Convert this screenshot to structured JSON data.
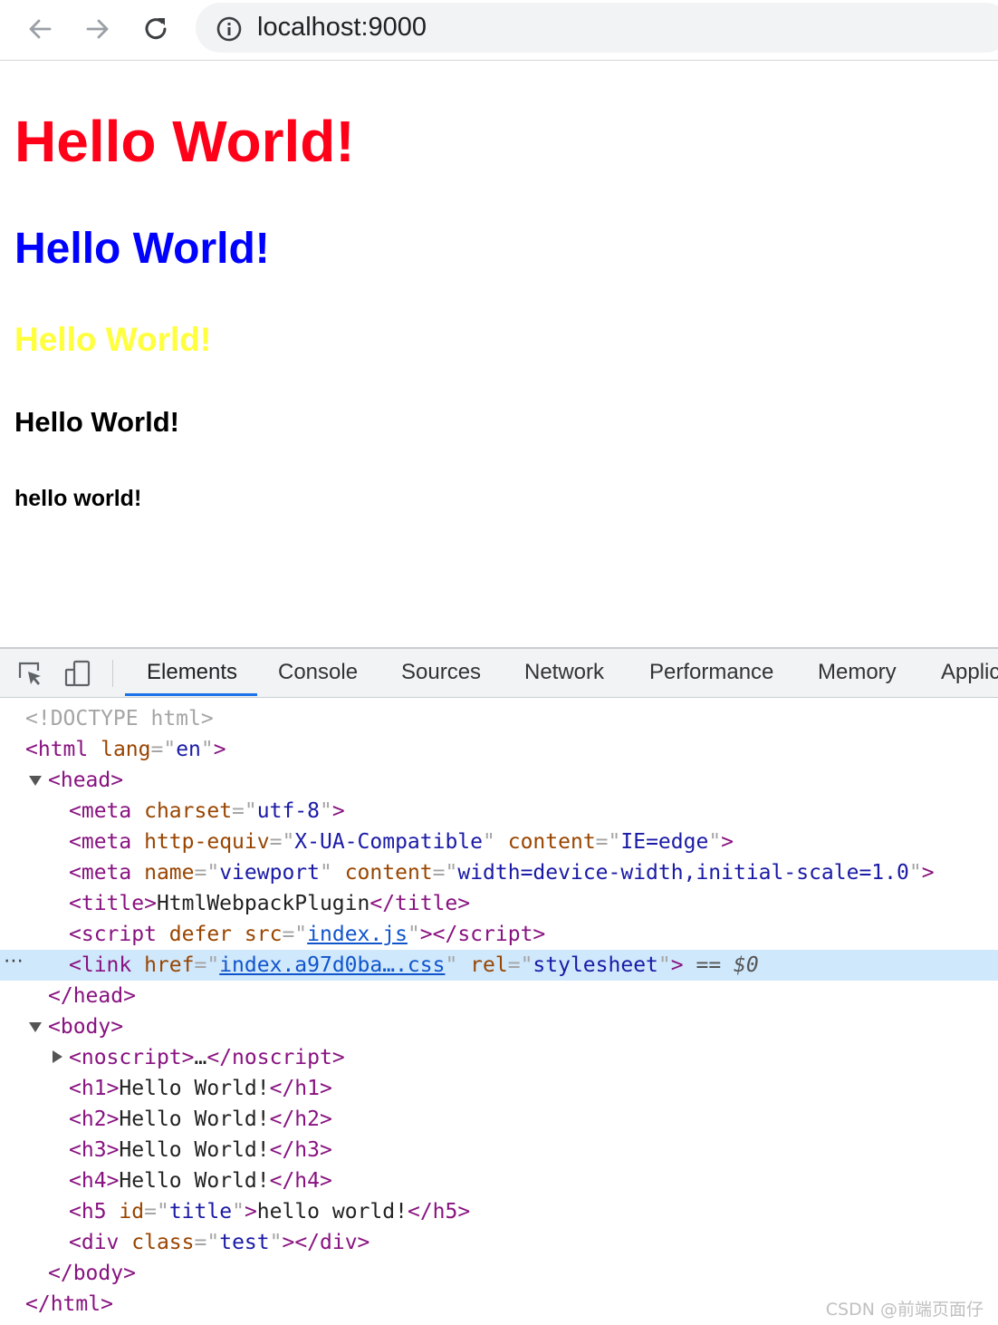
{
  "browser": {
    "url": "localhost:9000",
    "icons": {
      "back": "back-arrow-icon",
      "forward": "forward-arrow-icon",
      "reload": "reload-icon",
      "info": "info-icon"
    }
  },
  "page": {
    "h1": "Hello World!",
    "h2": "Hello World!",
    "h3": "Hello World!",
    "h4": "Hello World!",
    "h5": "hello world!",
    "colors": {
      "h1": "#ff0019",
      "h2": "#0000ff",
      "h3": "#ffff3d",
      "h4": "#000000",
      "h5": "#000000"
    }
  },
  "devtools": {
    "tabs": [
      "Elements",
      "Console",
      "Sources",
      "Network",
      "Performance",
      "Memory",
      "Applic"
    ],
    "active_tab": "Elements",
    "accent_color": "#1a73e8",
    "selected_row_color": "#cfe8fc",
    "tree": {
      "doctype": "<!DOCTYPE html>",
      "html_open": {
        "tag": "html",
        "attr": "lang",
        "value": "en"
      },
      "head": "head",
      "meta1": {
        "attr": "charset",
        "value": "utf-8"
      },
      "meta2": {
        "attr1": "http-equiv",
        "value1": "X-UA-Compatible",
        "attr2": "content",
        "value2": "IE=edge"
      },
      "meta3": {
        "attr1": "name",
        "value1": "viewport",
        "attr2": "content",
        "value2": "width=device-width,initial-scale=1.0"
      },
      "title": {
        "text": "HtmlWebpackPlugin"
      },
      "script": {
        "attr1": "defer",
        "attr2": "src",
        "value2": "index.js"
      },
      "link": {
        "attr1": "href",
        "value1": "index.a97d0ba….css",
        "attr2": "rel",
        "value2": "stylesheet",
        "marker": "== $0"
      },
      "head_close": "head",
      "body": "body",
      "noscript": {
        "tag": "noscript",
        "ellipsis": "…"
      },
      "h1": {
        "tag": "h1",
        "text": "Hello World!"
      },
      "h2": {
        "tag": "h2",
        "text": "Hello World!"
      },
      "h3": {
        "tag": "h3",
        "text": "Hello World!"
      },
      "h4": {
        "tag": "h4",
        "text": "Hello World!"
      },
      "h5": {
        "tag": "h5",
        "attr": "id",
        "value": "title",
        "text": "hello world!"
      },
      "div": {
        "tag": "div",
        "attr": "class",
        "value": "test"
      },
      "body_close": "body",
      "html_close": "html"
    }
  },
  "watermark": "CSDN @前端页面仔"
}
